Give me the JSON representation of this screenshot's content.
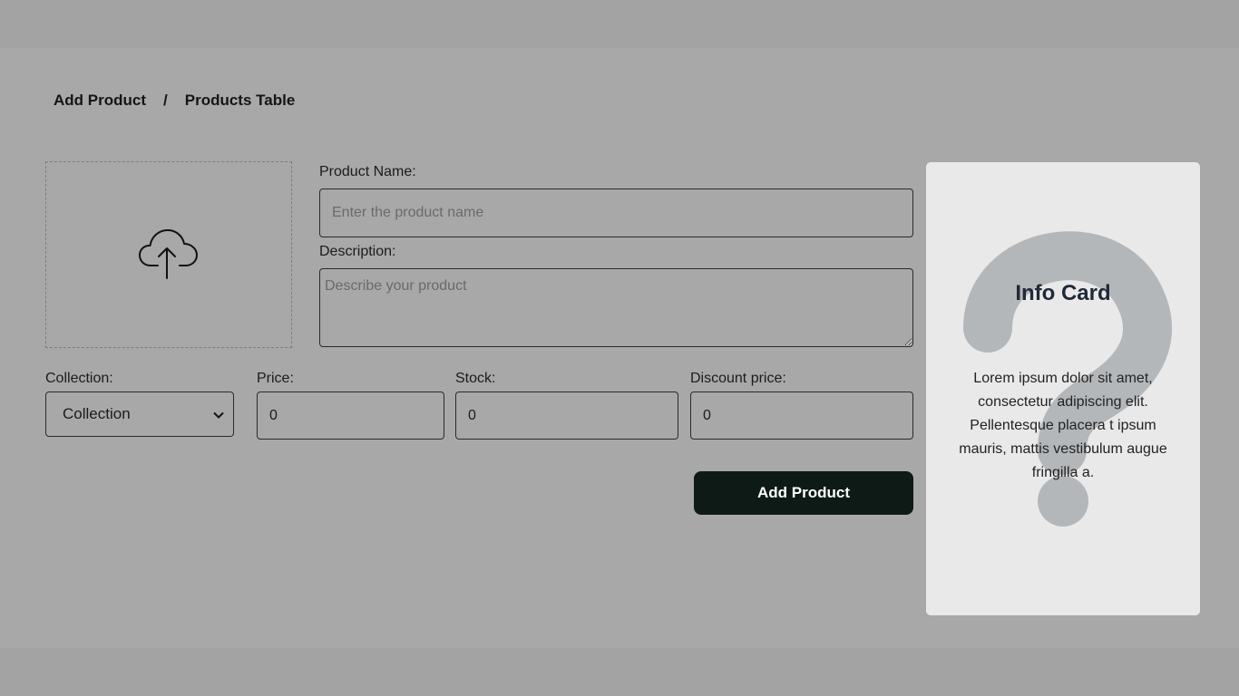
{
  "breadcrumb": {
    "add_product": "Add Product",
    "separator": "/",
    "products_table": "Products Table"
  },
  "upload": {
    "icon": "cloud-upload-icon"
  },
  "form": {
    "product_name": {
      "label": "Product Name:",
      "placeholder": "Enter the product name"
    },
    "description": {
      "label": "Description:",
      "placeholder": "Describe your product"
    },
    "collection": {
      "label": "Collection:",
      "value": "Collection"
    },
    "price": {
      "label": "Price:",
      "value": "0"
    },
    "stock": {
      "label": "Stock:",
      "value": "0"
    },
    "discount_price": {
      "label": "Discount price:",
      "value": "0"
    },
    "submit_label": "Add Product"
  },
  "info_card": {
    "title": "Info Card",
    "body": "Lorem ipsum dolor sit amet, consectetur adipiscing elit. Pellentesque placera t ipsum mauris, mattis vestibulum augue fringilla a.",
    "background_icon": "question-mark-icon"
  },
  "colors": {
    "page_background": "#a8a8a8",
    "button_background": "#0d1a16",
    "card_background": "#e9e9e9",
    "question_mark": "#b4b7ba"
  }
}
